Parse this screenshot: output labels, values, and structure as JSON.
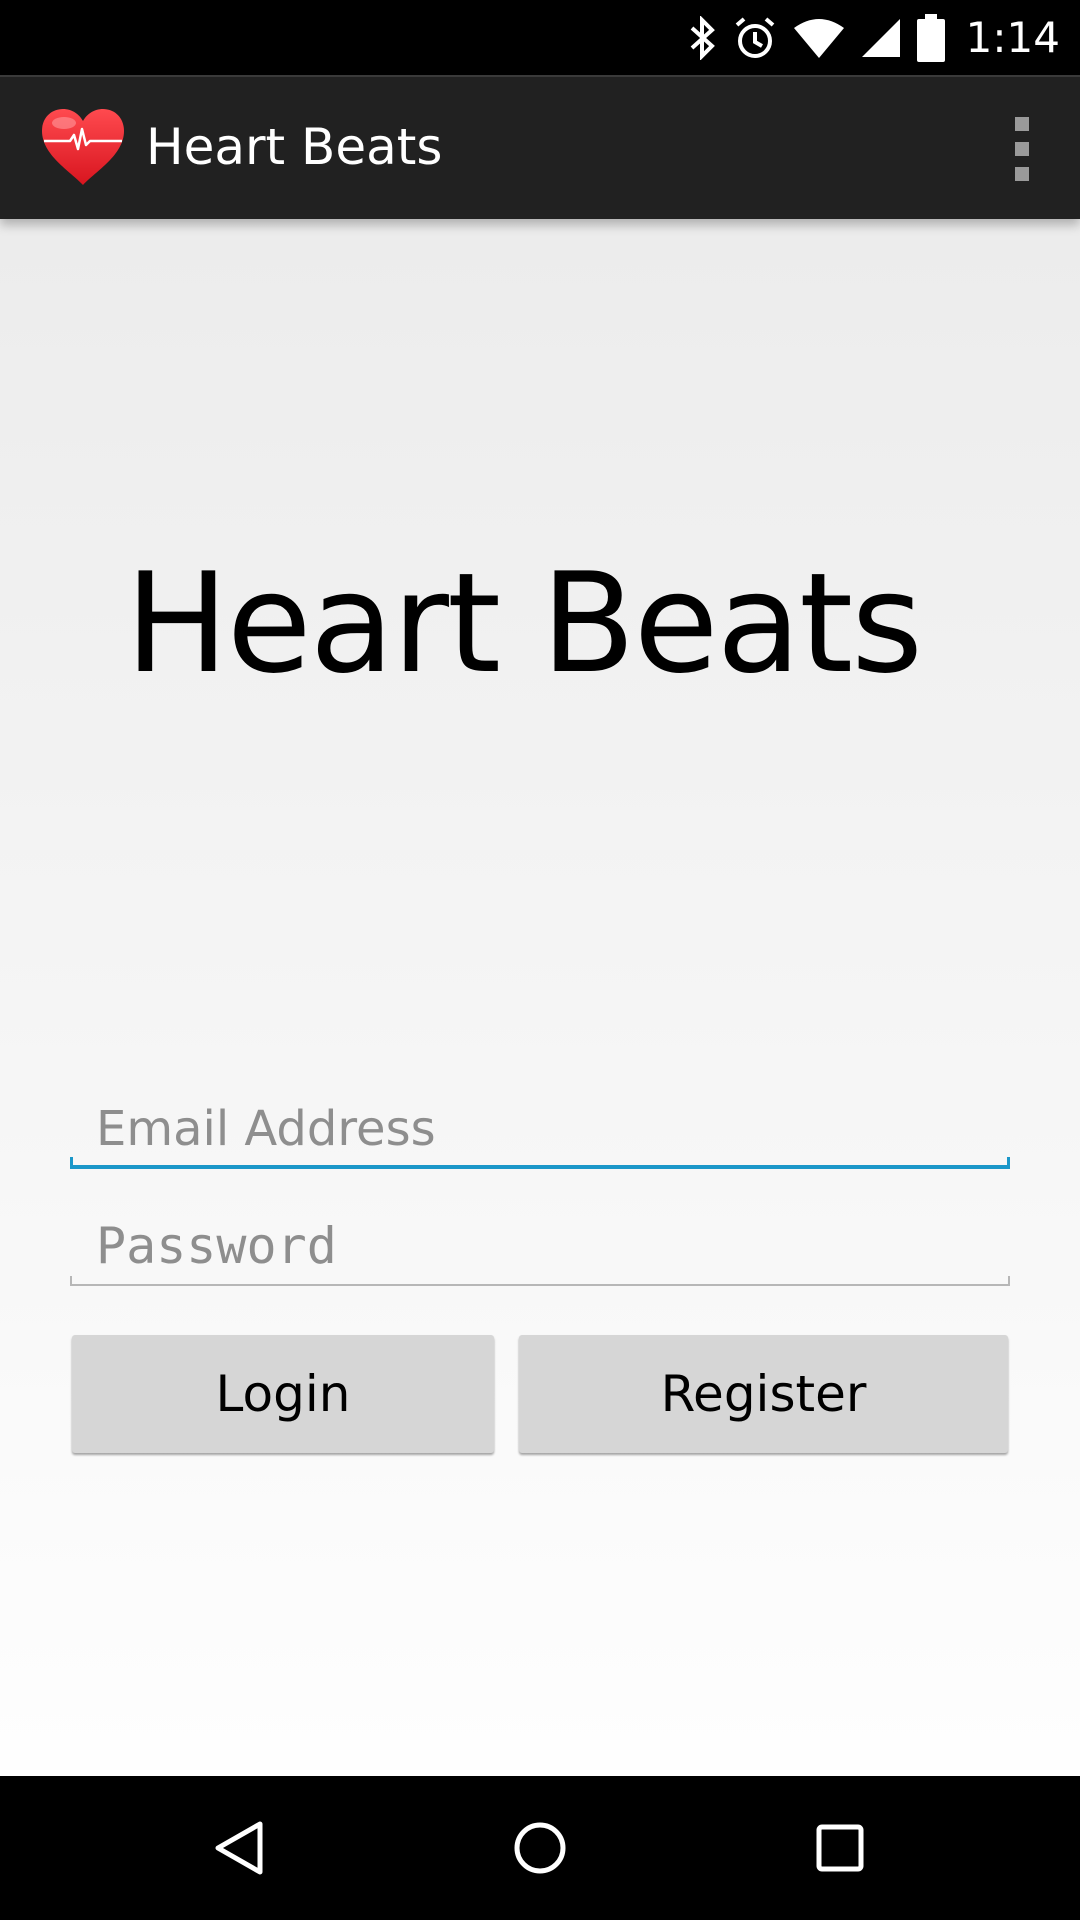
{
  "status_bar": {
    "time": "1:14",
    "icons": [
      "bluetooth-icon",
      "alarm-icon",
      "wifi-icon",
      "signal-icon",
      "battery-icon"
    ]
  },
  "action_bar": {
    "title": "Heart Beats",
    "app_icon": "heart-pulse-icon",
    "overflow_icon": "more-vert-icon"
  },
  "main": {
    "hero_title": "Heart Beats",
    "email": {
      "placeholder": "Email Address",
      "value": ""
    },
    "password": {
      "placeholder": "Password",
      "value": ""
    },
    "login_label": "Login",
    "register_label": "Register"
  },
  "nav_bar": {
    "back_icon": "back-icon",
    "home_icon": "home-icon",
    "recents_icon": "recents-icon"
  },
  "colors": {
    "accent": "#1b97c9",
    "action_bar": "#212121",
    "button": "#d6d6d6",
    "heart": "#e8212b"
  }
}
